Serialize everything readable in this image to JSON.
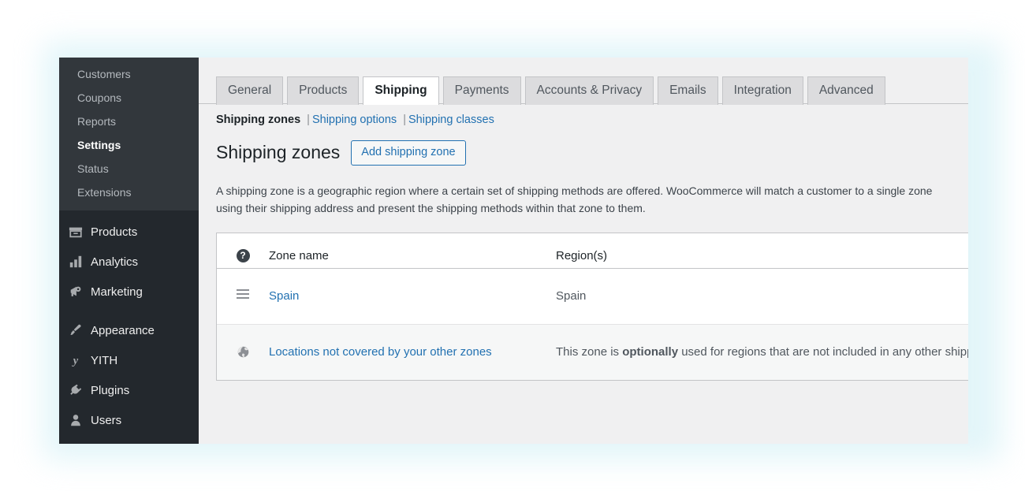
{
  "sidebar": {
    "submenu": [
      {
        "label": "Customers",
        "current": false
      },
      {
        "label": "Coupons",
        "current": false
      },
      {
        "label": "Reports",
        "current": false
      },
      {
        "label": "Settings",
        "current": true
      },
      {
        "label": "Status",
        "current": false
      },
      {
        "label": "Extensions",
        "current": false
      }
    ],
    "menu": [
      {
        "label": "Products",
        "icon": "products-icon"
      },
      {
        "label": "Analytics",
        "icon": "analytics-icon"
      },
      {
        "label": "Marketing",
        "icon": "marketing-icon"
      },
      {
        "label": "Appearance",
        "icon": "appearance-icon"
      },
      {
        "label": "YITH",
        "icon": "yith-icon"
      },
      {
        "label": "Plugins",
        "icon": "plugins-icon"
      },
      {
        "label": "Users",
        "icon": "users-icon"
      }
    ]
  },
  "tabs": [
    {
      "label": "General",
      "active": false
    },
    {
      "label": "Products",
      "active": false
    },
    {
      "label": "Shipping",
      "active": true
    },
    {
      "label": "Payments",
      "active": false
    },
    {
      "label": "Accounts & Privacy",
      "active": false
    },
    {
      "label": "Emails",
      "active": false
    },
    {
      "label": "Integration",
      "active": false
    },
    {
      "label": "Advanced",
      "active": false
    }
  ],
  "subnav": {
    "current": "Shipping zones",
    "links": [
      "Shipping options",
      "Shipping classes"
    ],
    "separator": "|"
  },
  "page": {
    "title": "Shipping zones",
    "add_button": "Add shipping zone",
    "description": "A shipping zone is a geographic region where a certain set of shipping methods are offered. WooCommerce will match a customer to a single zone using their shipping address and present the shipping methods within that zone to them."
  },
  "table": {
    "help_glyph": "?",
    "columns": {
      "zone_name": "Zone name",
      "regions": "Region(s)"
    },
    "rows": [
      {
        "icon": "drag-handle-icon",
        "name": "Spain",
        "region": "Spain",
        "region_bold": "",
        "region_tail": "",
        "alt": false
      },
      {
        "icon": "globe-icon",
        "name": "Locations not covered by your other zones",
        "region": "This zone is ",
        "region_bold": "optionally",
        "region_tail": " used for regions that are not included in any other shipping zone.",
        "alt": true
      }
    ]
  },
  "colors": {
    "sidebar_bg": "#23282d",
    "submenu_bg": "#32373c",
    "link_blue": "#2271b1",
    "content_bg": "#f0f0f1",
    "glow": "#d9f2f7"
  }
}
